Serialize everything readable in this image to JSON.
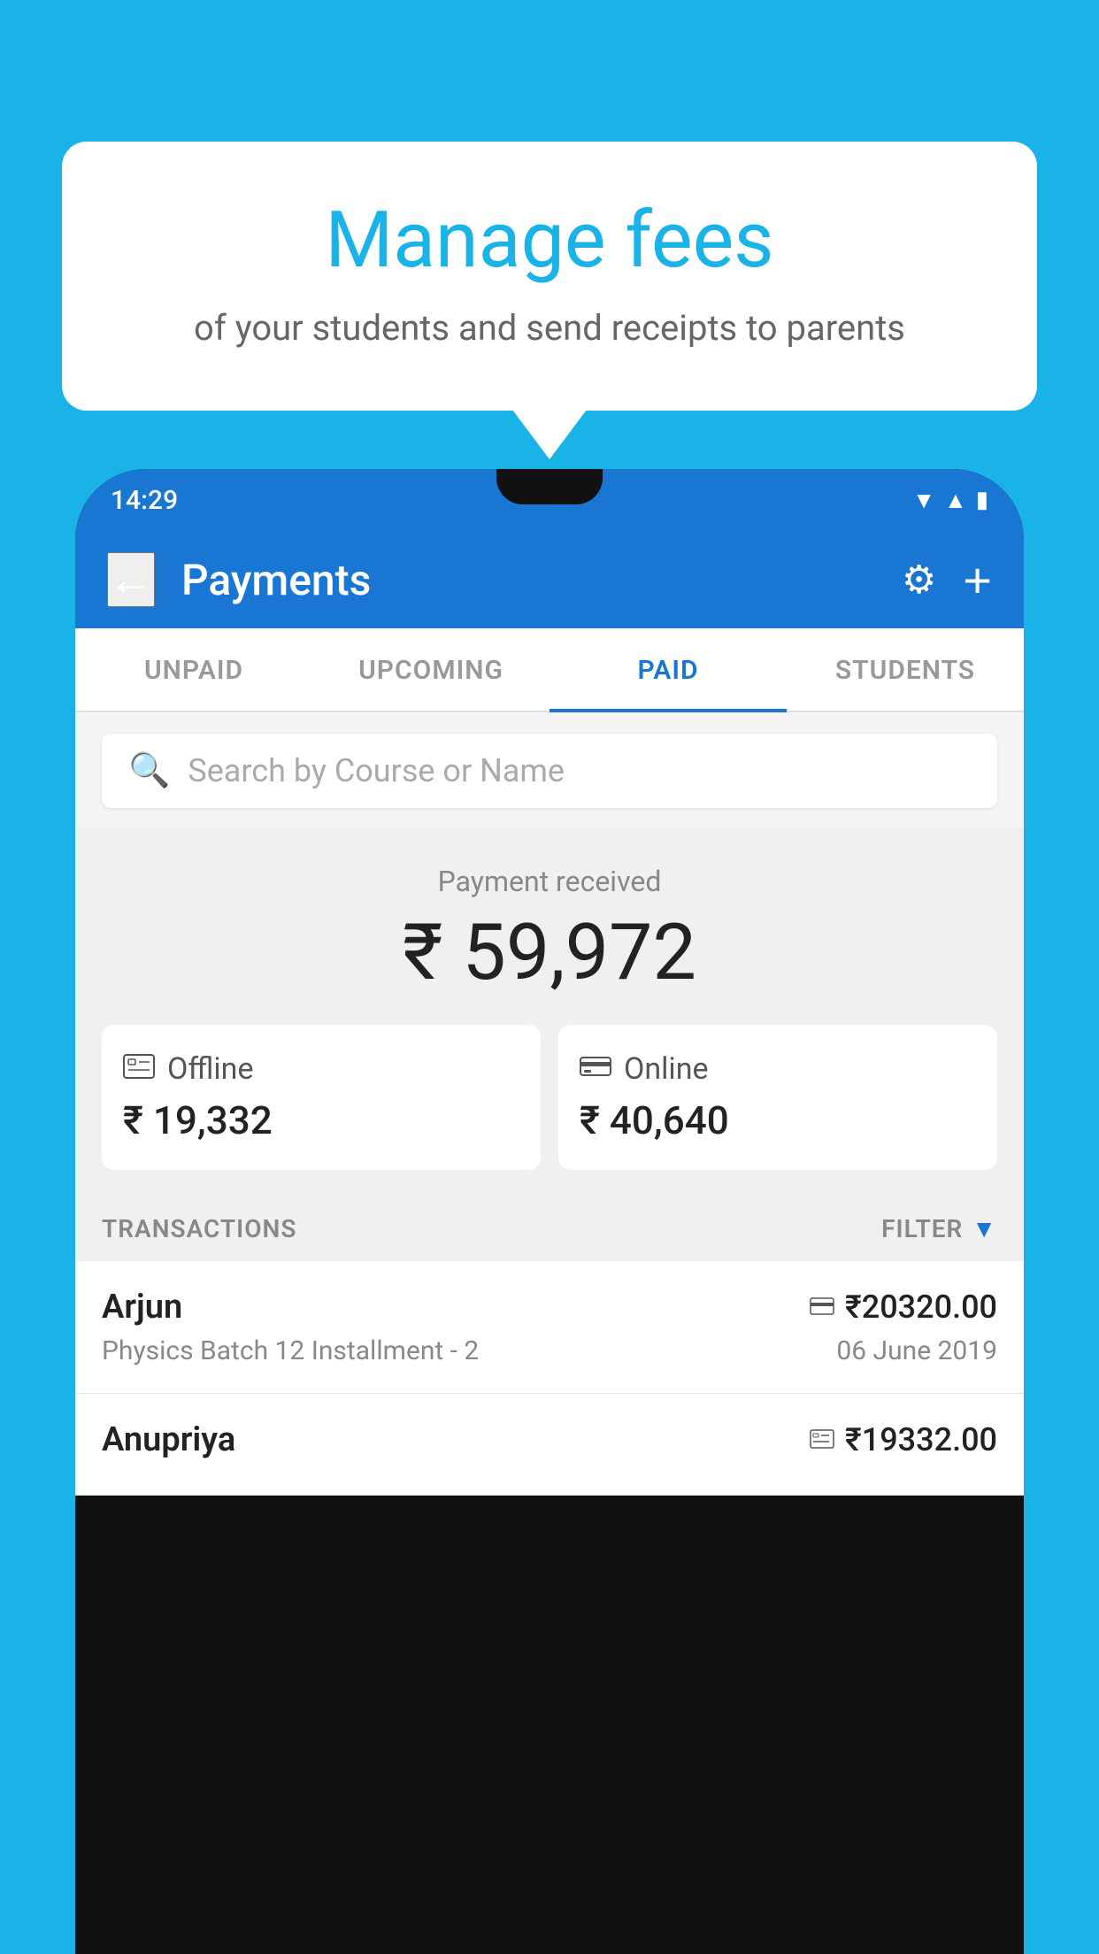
{
  "background_color": "#1ab3e8",
  "speech_bubble": {
    "title": "Manage fees",
    "subtitle": "of your students and send receipts to parents"
  },
  "phone": {
    "status_bar": {
      "time": "14:29",
      "wifi": "▼▲",
      "signal": "▲",
      "battery": "▮"
    },
    "app_header": {
      "title": "Payments",
      "back_label": "←",
      "settings_label": "⚙",
      "add_label": "+"
    },
    "tabs": [
      {
        "label": "UNPAID",
        "active": false
      },
      {
        "label": "UPCOMING",
        "active": false
      },
      {
        "label": "PAID",
        "active": true
      },
      {
        "label": "STUDENTS",
        "active": false
      }
    ],
    "search": {
      "placeholder": "Search by Course or Name"
    },
    "payment_received": {
      "label": "Payment received",
      "amount": "₹ 59,972"
    },
    "payment_cards": [
      {
        "type": "Offline",
        "icon": "cash",
        "amount": "₹ 19,332"
      },
      {
        "type": "Online",
        "icon": "card",
        "amount": "₹ 40,640"
      }
    ],
    "transactions_header": {
      "label": "TRANSACTIONS",
      "filter_label": "FILTER"
    },
    "transactions": [
      {
        "name": "Arjun",
        "course": "Physics Batch 12 Installment - 2",
        "amount": "₹20320.00",
        "date": "06 June 2019",
        "payment_type": "online"
      },
      {
        "name": "Anupriya",
        "course": "",
        "amount": "₹19332.00",
        "date": "",
        "payment_type": "offline"
      }
    ]
  }
}
